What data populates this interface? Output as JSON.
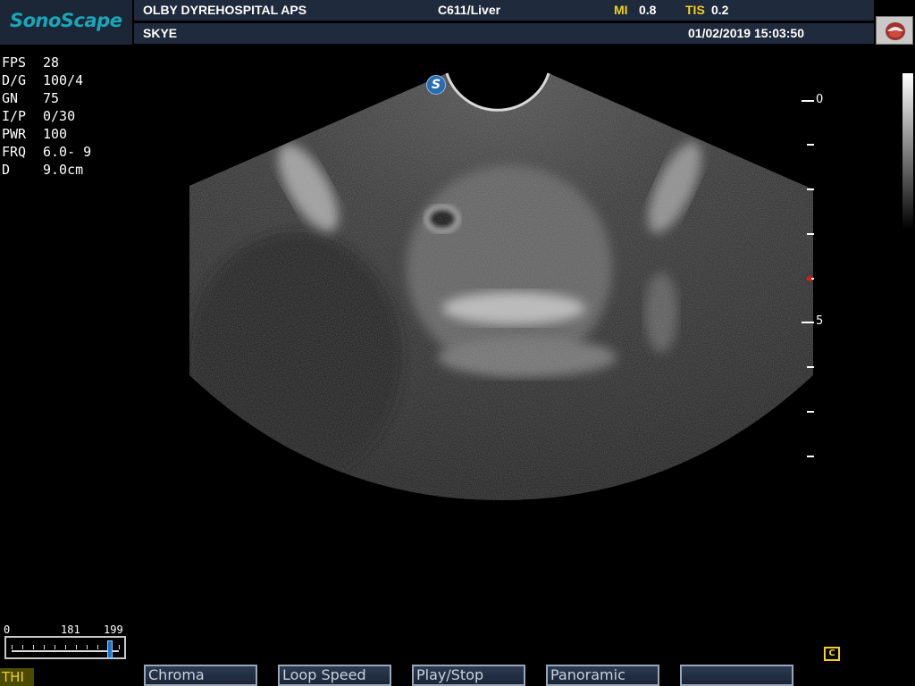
{
  "header": {
    "logo": "SonoScape",
    "hospital": "OLBY DYREHOSPITAL APS",
    "probe_preset": "C611/Liver",
    "mi_label": "MI",
    "mi_value": "0.8",
    "tis_label": "TIS",
    "tis_value": "0.2",
    "patient": "SKYE",
    "datetime": "01/02/2019 15:03:50"
  },
  "params": [
    {
      "key": "FPS",
      "value": "28"
    },
    {
      "key": "D/G",
      "value": "100/4"
    },
    {
      "key": "GN",
      "value": "75"
    },
    {
      "key": "I/P",
      "value": "0/30"
    },
    {
      "key": "PWR",
      "value": "100"
    },
    {
      "key": "FRQ",
      "value": "6.0- 9"
    },
    {
      "key": "D",
      "value": "9.0cm"
    }
  ],
  "depth_scale": {
    "labels": [
      "0",
      "5"
    ]
  },
  "cine": {
    "start": "0",
    "current": "181",
    "end": "199",
    "position": 0.91
  },
  "bottom": {
    "mode": "THI",
    "softkeys": [
      "Chroma",
      "Loop Speed",
      "Play/Stop",
      "Panoramic",
      ""
    ],
    "cine_icon": "C"
  },
  "colors": {
    "logo_teal": "#19a7b8",
    "accent_yellow": "#f2d21b",
    "header_bg": "#1f2a3c",
    "focus_red": "#e11111",
    "marker_blue": "#2b6cb0"
  },
  "icons": {
    "probe": "probe-icon",
    "orientation": "orientation-marker-icon",
    "cine": "cine-icon"
  }
}
